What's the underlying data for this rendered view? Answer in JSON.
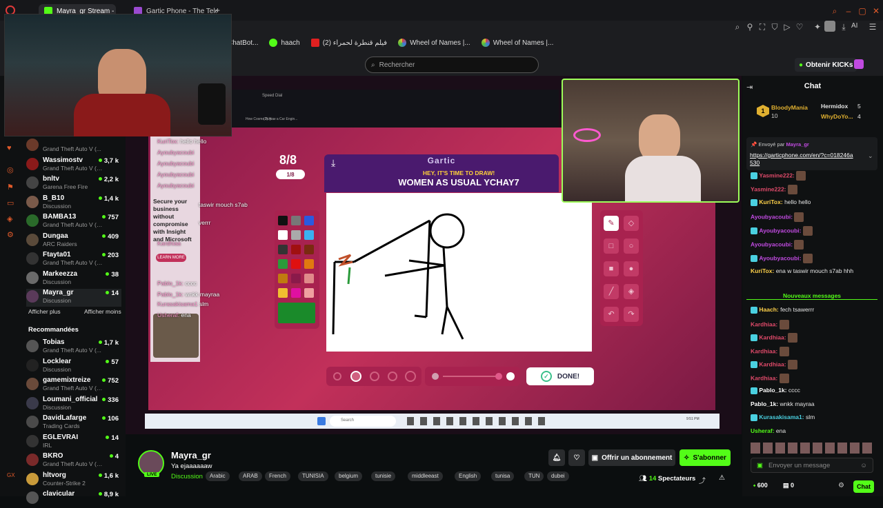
{
  "browser": {
    "tabs": [
      {
        "label": "Mayra_gr Stream - Wa"
      },
      {
        "label": "Gartic Phone - The Teleph"
      }
    ],
    "new_tab": "+",
    "bookmarks": [
      {
        "label": "ChatBot..."
      },
      {
        "label": "haach"
      },
      {
        "label": "(2) فيلم قنطرة لحمراء"
      },
      {
        "label": "Wheel of Names |..."
      },
      {
        "label": "Wheel of Names |..."
      }
    ],
    "search_placeholder": "Rechercher",
    "kicks_label": "Obtenir KICKs"
  },
  "sidebar": {
    "channels": [
      {
        "name": "",
        "game": "Grand Theft Auto V (...",
        "viewers": "",
        "color": "#6b3a2a"
      },
      {
        "name": "Wassimostv",
        "game": "Grand Theft Auto V (G...",
        "viewers": "3,7 k",
        "color": "#8a1a1a"
      },
      {
        "name": "bnltv",
        "game": "Garena Free Fire",
        "viewers": "2,2 k",
        "color": "#444"
      },
      {
        "name": "B_B10",
        "game": "Discussion",
        "viewers": "1,4 k",
        "color": "#7a5a4a"
      },
      {
        "name": "BAMBA13",
        "game": "Grand Theft Auto V (G...",
        "viewers": "757",
        "color": "#2a6a2a"
      },
      {
        "name": "Dungaa",
        "game": "ARC Raiders",
        "viewers": "409",
        "color": "#5a4a3a"
      },
      {
        "name": "Ftayta01",
        "game": "Grand Theft Auto V (G...",
        "viewers": "203",
        "color": "#333"
      },
      {
        "name": "Markeezza",
        "game": "Discussion",
        "viewers": "38",
        "color": "#6a6a6a"
      },
      {
        "name": "Mayra_gr",
        "game": "Discussion",
        "viewers": "14",
        "color": "#5a3a5a"
      }
    ],
    "show_more": "Afficher plus",
    "show_less": "Afficher moins",
    "recommended_title": "Recommandées",
    "recommended": [
      {
        "name": "Tobias",
        "game": "Grand Theft Auto V (...",
        "viewers": "1,7 k",
        "color": "#555"
      },
      {
        "name": "Locklear",
        "game": "Discussion",
        "viewers": "57",
        "color": "#222"
      },
      {
        "name": "gamemixtreize",
        "game": "Grand Theft Auto V (G...",
        "viewers": "752",
        "color": "#6a4a3a"
      },
      {
        "name": "Loumani_official",
        "game": "Discussion",
        "viewers": "336",
        "color": "#3a3a4a"
      },
      {
        "name": "DavidLafarge",
        "game": "Trading Cards",
        "viewers": "106",
        "color": "#4a4a4a"
      },
      {
        "name": "EGLEVRAI",
        "game": "IRL",
        "viewers": "14",
        "color": "#333"
      },
      {
        "name": "BKRO",
        "game": "Grand Theft Auto V (GTA)",
        "viewers": "4",
        "color": "#7a2a2a"
      },
      {
        "name": "hltvorg",
        "game": "Counter-Strike 2",
        "viewers": "1,6 k",
        "color": "#c89a3a"
      },
      {
        "name": "clavicular",
        "game": "",
        "viewers": "8,9 k",
        "color": "#555"
      }
    ]
  },
  "game": {
    "round": "8/8",
    "round_sub": "1/8",
    "logo": "Gartic",
    "prompt_small": "HEY, IT'S TIME TO DRAW!",
    "prompt_big": "WOMEN AS USUAL YCHAY7",
    "done": "DONE!",
    "inner_tabs": [
      "Speed Dial"
    ],
    "inner_tab2": "(2) How a Car Engin...",
    "inner_tab1": "How Cosmo Buy...",
    "ad_lines": [
      "Secure your",
      "business",
      "without",
      "compromise",
      "with Insight",
      "and Microsoft"
    ],
    "ad_button": "LEARN MORE",
    "overlay_chat": [
      {
        "who": "KuriTox:",
        "msg": "hello hello"
      },
      {
        "who": "Ayoubyacoubi",
        "msg": ""
      },
      {
        "who": "Ayoubyacoubi",
        "msg": ""
      },
      {
        "who": "Ayoubyacoubi",
        "msg": ""
      },
      {
        "who": "Ayoubyacoubi",
        "msg": ""
      },
      {
        "who": "",
        "msg": "taswir mouch s7ab"
      },
      {
        "who": "",
        "msg": "verrr"
      },
      {
        "who": "Kardhiaa",
        "msg": ""
      },
      {
        "who": "Pablo_1k:",
        "msg": "cccc"
      },
      {
        "who": "Pablo_1k:",
        "msg": "wnkk mayraa"
      },
      {
        "who": "Kurasakisama1",
        "msg": "slm"
      },
      {
        "who": "Usheraf:",
        "msg": "ena"
      }
    ],
    "taskbar_search": "Search",
    "taskbar_time": "9:51 PM"
  },
  "chat": {
    "title": "Chat",
    "leaders": [
      {
        "name": "BloodyMania",
        "count": "10"
      },
      {
        "name": "Hermidox",
        "count": "5"
      },
      {
        "name": "WhyDoYo...",
        "count": "4"
      }
    ],
    "sent_by": "Envoyé par",
    "sent_by_user": "Mayra_gr",
    "link": "https://garticphone.com/en/?c=018246a530",
    "messages": [
      {
        "who": "Yasmine222:",
        "msg": "",
        "color": "#e04a6a"
      },
      {
        "who": "Yasmine222:",
        "msg": "",
        "color": "#e04a6a"
      },
      {
        "who": "KuriTox:",
        "msg": "hello hello",
        "color": "#ffd24a"
      },
      {
        "who": "Ayoubyacoubi:",
        "msg": "",
        "color": "#c04ae0"
      },
      {
        "who": "Ayoubyacoubi:",
        "msg": "",
        "color": "#c04ae0"
      },
      {
        "who": "Ayoubyacoubi:",
        "msg": "",
        "color": "#c04ae0"
      },
      {
        "who": "Ayoubyacoubi:",
        "msg": "",
        "color": "#c04ae0"
      },
      {
        "who": "KuriTox:",
        "msg": "ena w taswir mouch s7ab hhh",
        "color": "#ffd24a"
      }
    ],
    "new_messages": "Nouveaux messages",
    "messages2": [
      {
        "who": "Haach:",
        "msg": "fech tsawerrr",
        "color": "#ffd24a"
      },
      {
        "who": "Kardhiaa:",
        "msg": "",
        "color": "#e04a6a"
      },
      {
        "who": "Kardhiaa:",
        "msg": "",
        "color": "#e04a6a"
      },
      {
        "who": "Kardhiaa:",
        "msg": "",
        "color": "#e04a6a"
      },
      {
        "who": "Kardhiaa:",
        "msg": "",
        "color": "#e04a6a"
      },
      {
        "who": "Kardhiaa:",
        "msg": "",
        "color": "#e04a6a"
      },
      {
        "who": "Pablo_1k:",
        "msg": "cccc",
        "color": "#fff"
      },
      {
        "who": "Pablo_1k:",
        "msg": "wnkk mayraa",
        "color": "#fff"
      },
      {
        "who": "Kurasakisama1:",
        "msg": "slm",
        "color": "#4ad0e0"
      },
      {
        "who": "Usheraf:",
        "msg": "ena",
        "color": "#53fc18"
      }
    ],
    "input_placeholder": "Envoyer un message",
    "points": "600",
    "gifts": "0",
    "send": "Chat"
  },
  "stream": {
    "name": "Mayra_gr",
    "title": "Ya ejaaaaaaw",
    "live": "LIVE",
    "category": "Discussion",
    "tags": [
      "Arabic",
      "ARAB",
      "French",
      "TUNISIA",
      "belgium",
      "tunisie",
      "middleeast",
      "English",
      "tunisa",
      "TUN",
      "dubei"
    ],
    "gift_sub": "Offrir un abonnement",
    "subscribe": "S'abonner",
    "viewers": "14",
    "viewers_label": "Spectateurs"
  },
  "colors": {
    "kick_green": "#53fc18",
    "accent_pink": "#c2305a"
  }
}
